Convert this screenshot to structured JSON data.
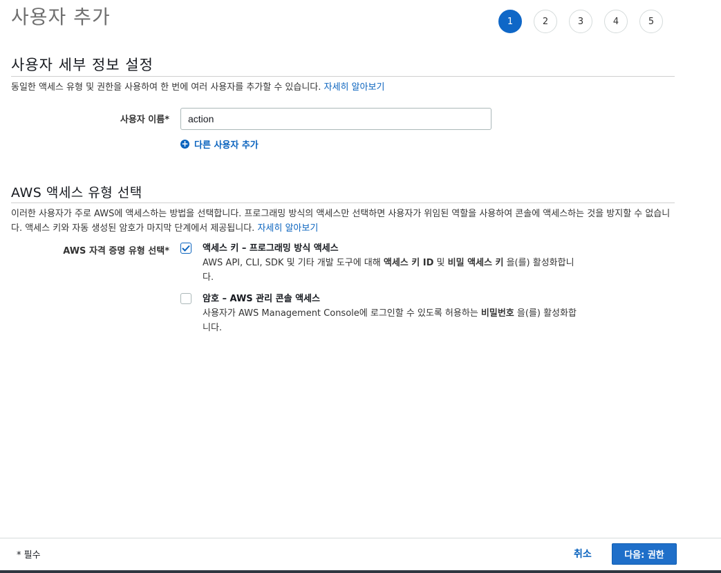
{
  "page_title": "사용자 추가",
  "steps": [
    "1",
    "2",
    "3",
    "4",
    "5"
  ],
  "active_step": "1",
  "details": {
    "title": "사용자 세부 정보 설정",
    "description": "동일한 액세스 유형 및 권한을 사용하여 한 번에 여러 사용자를 추가할 수 있습니다.",
    "learn_more": "자세히 알아보기",
    "username_label": "사용자 이름*",
    "username_value": "action",
    "add_user_label": "다른 사용자 추가"
  },
  "access": {
    "title": "AWS 액세스 유형 선택",
    "description": "이러한 사용자가 주로 AWS에 액세스하는 방법을 선택합니다. 프로그래밍 방식의 액세스만 선택하면 사용자가 위임된 역할을 사용하여 콘솔에 액세스하는 것을 방지할 수 없습니다. 액세스 키와 자동 생성된 암호가 마지막 단계에서 제공됩니다.",
    "learn_more": "자세히 알아보기",
    "credential_label": "AWS 자격 증명 유형 선택*",
    "options": [
      {
        "title": "액세스 키 – 프로그래밍 방식 액세스",
        "desc_pre": "AWS API, CLI, SDK 및 기타 개발 도구에 대해 ",
        "bold1": "액세스 키 ID",
        "mid": " 및 ",
        "bold2": "비밀 액세스 키",
        "desc_post": " 을(를) 활성화합니다.",
        "checked": true
      },
      {
        "title": "암호 – AWS 관리 콘솔 액세스",
        "desc_pre": "사용자가 AWS Management Console에 로그인할 수 있도록 허용하는 ",
        "bold1": "비밀번호",
        "desc_post": " 을(를) 활성화합니다.",
        "checked": false
      }
    ]
  },
  "footer": {
    "required_note": "* 필수",
    "cancel_label": "취소",
    "next_label": "다음: 권한"
  },
  "colors": {
    "primary": "#0f67c7",
    "link": "#0a63be"
  }
}
